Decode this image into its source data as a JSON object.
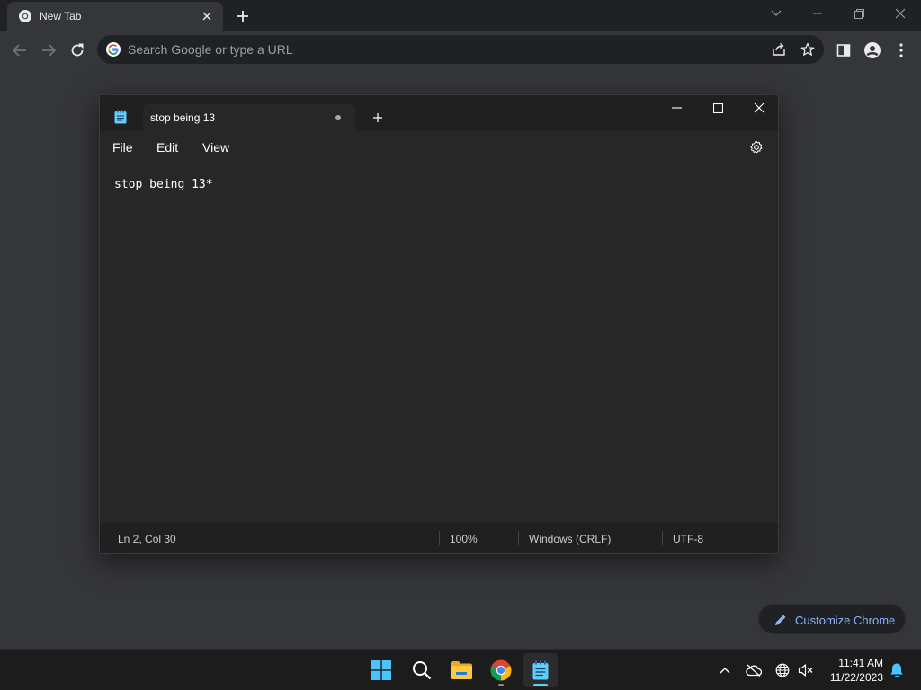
{
  "browser": {
    "tab_title": "New Tab",
    "omnibox_placeholder": "Search Google or type a URL",
    "customize_label": "Customize Chrome"
  },
  "notepad": {
    "tab_title": "stop being 13",
    "menu": [
      "File",
      "Edit",
      "View"
    ],
    "lines": [
      "stop being 13*",
      ""
    ],
    "status": {
      "position": "Ln 2, Col 30",
      "zoom": "100%",
      "line_ending": "Windows (CRLF)",
      "encoding": "UTF-8"
    }
  },
  "taskbar": {
    "time": "11:41 AM",
    "date": "11/22/2023"
  },
  "colors": {
    "chrome_frame": "#202124",
    "chrome_toolbar": "#35363a",
    "notepad_bg": "#272727",
    "accent": "#60cdff",
    "link_blue": "#8ab4f8"
  }
}
